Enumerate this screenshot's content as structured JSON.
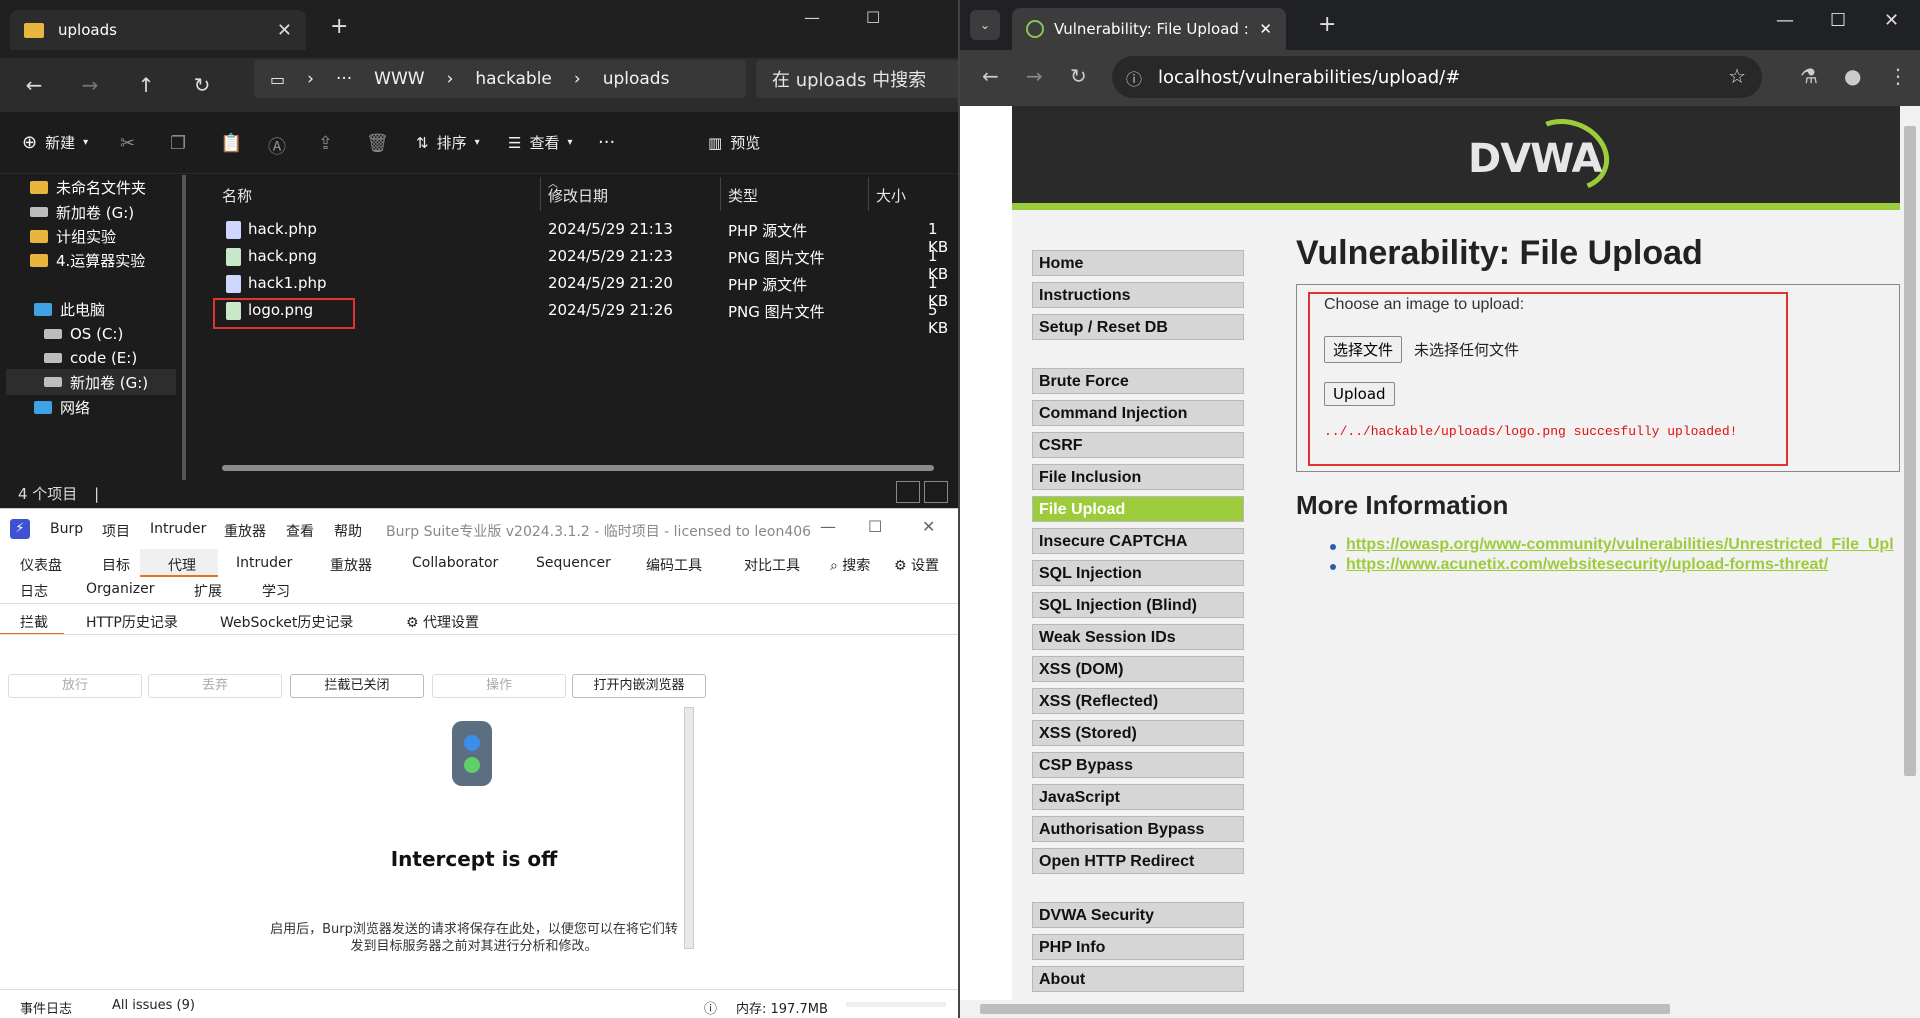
{
  "explorer": {
    "tab_title": "uploads",
    "breadcrumb": [
      "WWW",
      "hackable",
      "uploads"
    ],
    "breadcrumb_more": "···",
    "search_placeholder": "在 uploads 中搜索",
    "toolbar": {
      "new": "新建",
      "sort": "排序",
      "view": "查看",
      "more": "···",
      "preview": "预览"
    },
    "nav_items": [
      {
        "label": "未命名文件夹",
        "icon": "folder-icon"
      },
      {
        "label": "新加卷 (G:)",
        "icon": "drive-icon"
      },
      {
        "label": "计组实验",
        "icon": "folder-icon"
      },
      {
        "label": "4.运算器实验",
        "icon": "folder-icon"
      },
      {
        "label": "此电脑",
        "icon": "computer-icon"
      },
      {
        "label": "OS (C:)",
        "icon": "drive-icon"
      },
      {
        "label": "code (E:)",
        "icon": "drive-icon"
      },
      {
        "label": "新加卷 (G:)",
        "icon": "drive-icon"
      },
      {
        "label": "网络",
        "icon": "network-icon"
      }
    ],
    "columns": [
      "名称",
      "修改日期",
      "类型",
      "大小"
    ],
    "files": [
      {
        "name": "hack.php",
        "date": "2024/5/29 21:13",
        "type": "PHP 源文件",
        "size": "1 KB",
        "icon": "php-file-icon"
      },
      {
        "name": "hack.png",
        "date": "2024/5/29 21:23",
        "type": "PNG 图片文件",
        "size": "1 KB",
        "icon": "png-file-icon"
      },
      {
        "name": "hack1.php",
        "date": "2024/5/29 21:20",
        "type": "PHP 源文件",
        "size": "1 KB",
        "icon": "php-file-icon"
      },
      {
        "name": "logo.png",
        "date": "2024/5/29 21:26",
        "type": "PNG 图片文件",
        "size": "5 KB",
        "icon": "png-file-icon"
      }
    ],
    "status": "4 个项目",
    "status_sep": "|"
  },
  "burp": {
    "menu": [
      "Burp",
      "项目",
      "Intruder",
      "重放器",
      "查看",
      "帮助"
    ],
    "version": "Burp Suite专业版  v2024.3.1.2 - 临时项目 - licensed to leon406",
    "tabs_row1": [
      "仪表盘",
      "目标",
      "代理",
      "Intruder",
      "重放器",
      "Collaborator",
      "Sequencer",
      "编码工具",
      "对比工具"
    ],
    "search": "搜索",
    "settings": "设置",
    "tabs_row2": [
      "日志",
      "Organizer",
      "扩展",
      "学习"
    ],
    "subtabs": [
      "拦截",
      "HTTP历史记录",
      "WebSocket历史记录"
    ],
    "proxy_settings": "代理设置",
    "buttons": [
      "放行",
      "丢弃",
      "拦截已关闭",
      "操作",
      "打开内嵌浏览器"
    ],
    "intercept_title": "Intercept is off",
    "intercept_desc": "启用后，Burp浏览器发送的请求将保存在此处，以便您可以在将它们转发到目标服务器之前对其进行分析和修改。",
    "status_log": "事件日志",
    "status_issues": "All issues (9)",
    "status_memory": "内存: 197.7MB"
  },
  "chrome": {
    "tab_title": "Vulnerability: File Upload :: D",
    "url": "localhost/vulnerabilities/upload/#",
    "logo": "DVWA",
    "menu_group1": [
      "Home",
      "Instructions",
      "Setup / Reset DB"
    ],
    "menu_group2": [
      "Brute Force",
      "Command Injection",
      "CSRF",
      "File Inclusion",
      "File Upload",
      "Insecure CAPTCHA",
      "SQL Injection",
      "SQL Injection (Blind)",
      "Weak Session IDs",
      "XSS (DOM)",
      "XSS (Reflected)",
      "XSS (Stored)",
      "CSP Bypass",
      "JavaScript",
      "Authorisation Bypass",
      "Open HTTP Redirect"
    ],
    "menu_group3": [
      "DVWA Security",
      "PHP Info",
      "About"
    ],
    "active_menu": "File Upload",
    "heading": "Vulnerability: File Upload",
    "choose_label": "Choose an image to upload:",
    "file_button": "选择文件",
    "no_file": "未选择任何文件",
    "upload_button": "Upload",
    "message": "../../hackable/uploads/logo.png succesfully uploaded!",
    "more_info": "More Information",
    "links": [
      "https://owasp.org/www-community/vulnerabilities/Unrestricted_File_Upl",
      "https://www.acunetix.com/websitesecurity/upload-forms-threat/"
    ]
  },
  "colors": {
    "dvwa_green": "#9ccc3c",
    "highlight_red": "#e03434",
    "burp_orange": "#e8702a"
  }
}
